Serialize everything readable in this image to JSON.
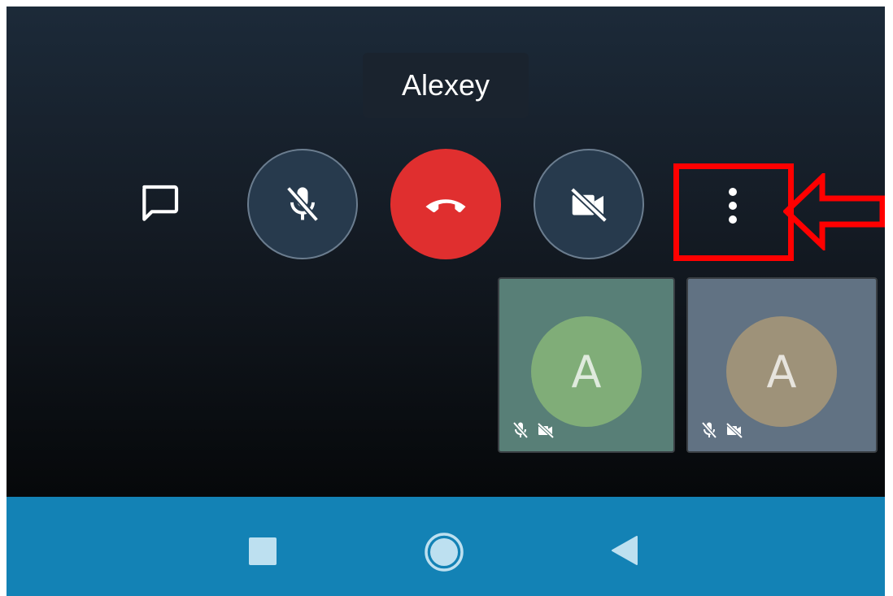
{
  "call": {
    "participant_name": "Alexey"
  },
  "controls": {
    "chat": {
      "icon": "chat-icon"
    },
    "mic": {
      "icon": "mic-off-icon",
      "state": "muted"
    },
    "hangup": {
      "icon": "hang-up-icon",
      "color": "#e02f2f"
    },
    "camera": {
      "icon": "video-off-icon",
      "state": "off"
    },
    "more": {
      "icon": "more-vertical-icon"
    }
  },
  "annotation": {
    "highlight_color": "#ff0000",
    "target": "more-options-button"
  },
  "tiles": [
    {
      "initial": "A",
      "avatar_color": "#80ad78",
      "tile_color": "#587f77",
      "mic": "muted",
      "camera": "off"
    },
    {
      "initial": "A",
      "avatar_color": "#9e9279",
      "tile_color": "#617283",
      "mic": "muted",
      "camera": "off"
    }
  ],
  "navbar": {
    "color": "#1382b5",
    "buttons": [
      "recents",
      "home",
      "back"
    ]
  }
}
